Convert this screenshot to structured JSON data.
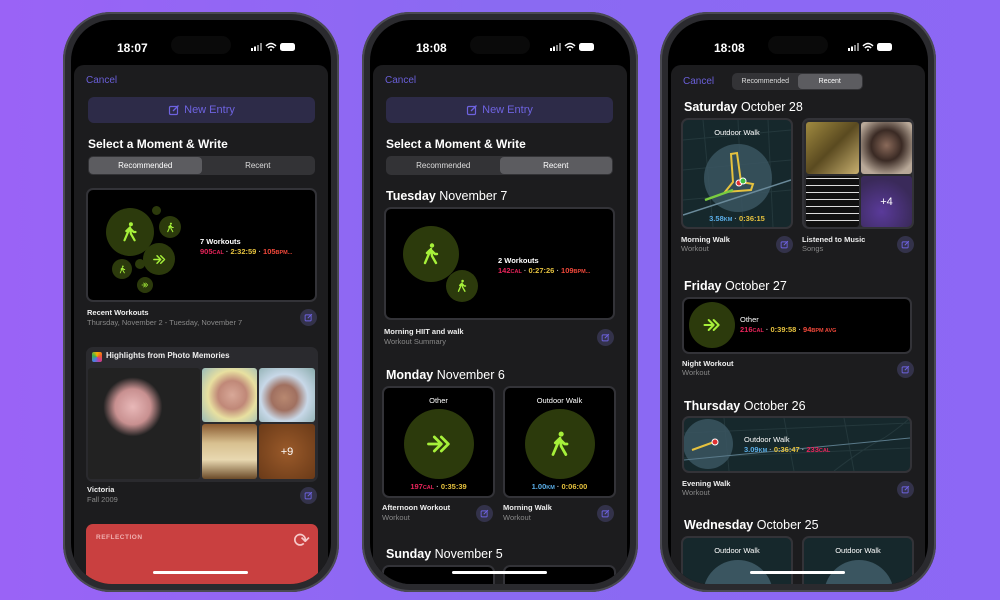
{
  "colors": {
    "accent": "#6a5fd8",
    "ring_green": "#a6f03a",
    "calories": "#e8245a",
    "time": "#e6c23e",
    "heart_rate": "#f0483a",
    "distance": "#5aaee8",
    "reflection": "#c94040"
  },
  "p1": {
    "status_time": "18:07",
    "cancel": "Cancel",
    "new_entry": "New Entry",
    "title": "Select a Moment & Write",
    "tabs": [
      "Recommended",
      "Recent"
    ],
    "selected_tab": "Recommended",
    "workouts": {
      "count": "7 Workouts",
      "cal": "905",
      "cal_unit": "CAL",
      "time": "2:32:59",
      "bpm": "105",
      "bpm_unit": "BPM...",
      "label": "Recent Workouts",
      "sub": "Thursday, November 2 - Tuesday, November 7"
    },
    "photos": {
      "header": "Highlights from Photo Memories",
      "more": "+9",
      "label": "Victoria",
      "sub": "Fall 2009"
    },
    "reflection": {
      "label": "REFLECTION"
    }
  },
  "p2": {
    "status_time": "18:08",
    "cancel": "Cancel",
    "new_entry": "New Entry",
    "title": "Select a Moment & Write",
    "tabs": [
      "Recommended",
      "Recent"
    ],
    "selected_tab": "Recent",
    "days": [
      {
        "weekday": "Tuesday",
        "date": "November 7"
      },
      {
        "weekday": "Monday",
        "date": "November 6"
      },
      {
        "weekday": "Sunday",
        "date": "November 5"
      }
    ],
    "tue": {
      "count": "2 Workouts",
      "cal": "142",
      "cal_unit": "CAL",
      "time": "0:27:26",
      "bpm": "109",
      "bpm_unit": "BPM...",
      "label": "Morning HIIT and walk",
      "sub": "Workout Summary"
    },
    "mon": [
      {
        "type": "Other",
        "cal": "197",
        "cal_unit": "CAL",
        "time": "0:35:39",
        "label": "Afternoon Workout",
        "sub": "Workout"
      },
      {
        "type": "Outdoor Walk",
        "km": "1.00",
        "km_unit": "KM",
        "time": "0:06:00",
        "label": "Morning Walk",
        "sub": "Workout"
      }
    ]
  },
  "p3": {
    "status_time": "18:08",
    "cancel": "Cancel",
    "tabs": [
      "Recommended",
      "Recent"
    ],
    "selected_tab": "Recent",
    "days": [
      {
        "weekday": "Saturday",
        "date": "October 28"
      },
      {
        "weekday": "Friday",
        "date": "October 27"
      },
      {
        "weekday": "Thursday",
        "date": "October 26"
      },
      {
        "weekday": "Wednesday",
        "date": "October 25"
      }
    ],
    "sat": [
      {
        "type": "Outdoor Walk",
        "km": "3.58",
        "km_unit": "KM",
        "time": "0:36:15",
        "label": "Morning Walk",
        "sub": "Workout"
      },
      {
        "more": "+4",
        "label": "Listened to Music",
        "sub": "Songs"
      }
    ],
    "fri": {
      "type": "Other",
      "cal": "216",
      "cal_unit": "CAL",
      "time": "0:39:58",
      "bpm": "94",
      "bpm_unit": "BPM AVG",
      "label": "Night Workout",
      "sub": "Workout"
    },
    "thu": {
      "type": "Outdoor Walk",
      "km": "3.09",
      "km_unit": "KM",
      "time": "0:36:47",
      "cal": "233",
      "cal_unit": "CAL",
      "label": "Evening Walk",
      "sub": "Workout"
    },
    "wed": [
      {
        "type": "Outdoor Walk"
      },
      {
        "type": "Outdoor Walk"
      }
    ]
  }
}
